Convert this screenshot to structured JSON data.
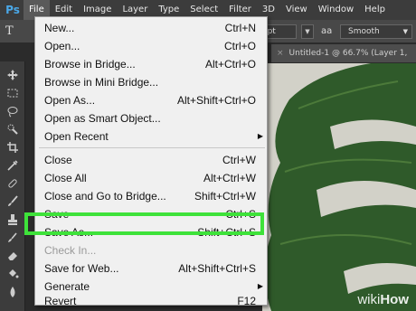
{
  "app": {
    "logo": "Ps",
    "menubar": [
      "File",
      "Edit",
      "Image",
      "Layer",
      "Type",
      "Select",
      "Filter",
      "3D",
      "View",
      "Window",
      "Help"
    ]
  },
  "options_bar": {
    "font_size": "0 pt",
    "antialias_label": "aa",
    "antialias_value": "Smooth"
  },
  "document_tab": {
    "title": "Untitled-1 @ 66.7% (Layer 1,"
  },
  "file_menu": {
    "items": [
      {
        "label": "New...",
        "shortcut": "Ctrl+N"
      },
      {
        "label": "Open...",
        "shortcut": "Ctrl+O"
      },
      {
        "label": "Browse in Bridge...",
        "shortcut": "Alt+Ctrl+O"
      },
      {
        "label": "Browse in Mini Bridge...",
        "shortcut": ""
      },
      {
        "label": "Open As...",
        "shortcut": "Alt+Shift+Ctrl+O"
      },
      {
        "label": "Open as Smart Object...",
        "shortcut": ""
      },
      {
        "label": "Open Recent",
        "shortcut": ""
      },
      {
        "label": "Close",
        "shortcut": "Ctrl+W"
      },
      {
        "label": "Close All",
        "shortcut": "Alt+Ctrl+W"
      },
      {
        "label": "Close and Go to Bridge...",
        "shortcut": "Shift+Ctrl+W"
      },
      {
        "label": "Save",
        "shortcut": "Ctrl+S"
      },
      {
        "label": "Save As...",
        "shortcut": "Shift+Ctrl+S"
      },
      {
        "label": "Check In...",
        "shortcut": ""
      },
      {
        "label": "Save for Web...",
        "shortcut": "Alt+Shift+Ctrl+S"
      },
      {
        "label": "Generate",
        "shortcut": ""
      },
      {
        "label": "Revert",
        "shortcut": "F12"
      }
    ]
  },
  "watermark": {
    "prefix": "wiki",
    "suffix": "How"
  },
  "colors": {
    "highlight": "#3ee23a",
    "canvas_bg": "#d2d1c8",
    "leaf": "#2f5a2a"
  }
}
